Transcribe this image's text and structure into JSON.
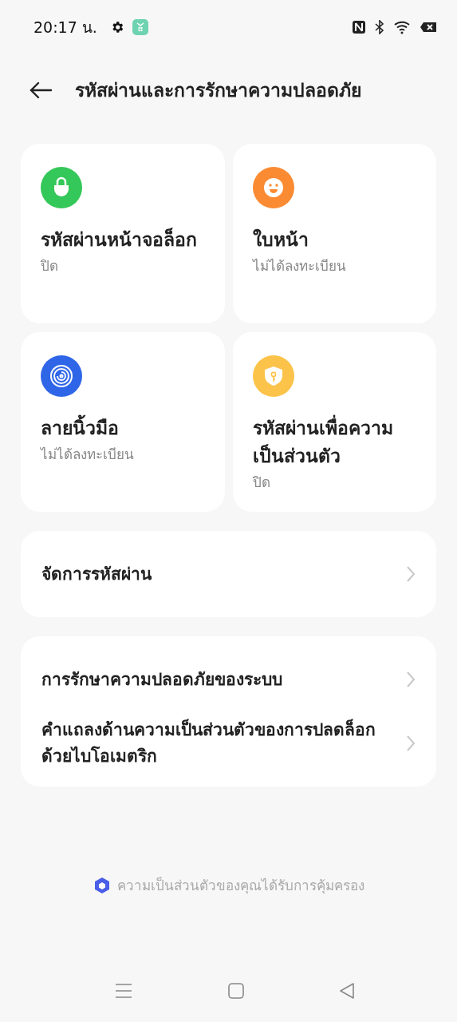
{
  "status_bar": {
    "time": "20:17 น."
  },
  "header": {
    "title": "รหัสผ่านและการรักษาความปลอดภัย"
  },
  "tiles": [
    {
      "kind": "lock",
      "color": "#34c759",
      "title": "รหัสผ่านหน้าจอล็อก",
      "status": "ปิด"
    },
    {
      "kind": "face",
      "color": "#fb8b33",
      "title": "ใบหน้า",
      "status": "ไม่ได้ลงทะเบียน"
    },
    {
      "kind": "fingerprint",
      "color": "#2f66e8",
      "title": "ลายนิ้วมือ",
      "status": "ไม่ได้ลงทะเบียน"
    },
    {
      "kind": "shield",
      "color": "#fcc34a",
      "title": "รหัสผ่านเพื่อความเป็นส่วนตัว",
      "status": "ปิด"
    }
  ],
  "groups": [
    {
      "items": [
        {
          "label": "จัดการรหัสผ่าน"
        }
      ]
    },
    {
      "items": [
        {
          "label": "การรักษาความปลอดภัยของระบบ"
        },
        {
          "label": "คำแถลงด้านความเป็นส่วนตัวของการปลดล็อกด้วยไบโอเมตริก"
        }
      ]
    }
  ],
  "footer": {
    "text": "ความเป็นส่วนตัวของคุณได้รับการคุ้มครอง"
  }
}
